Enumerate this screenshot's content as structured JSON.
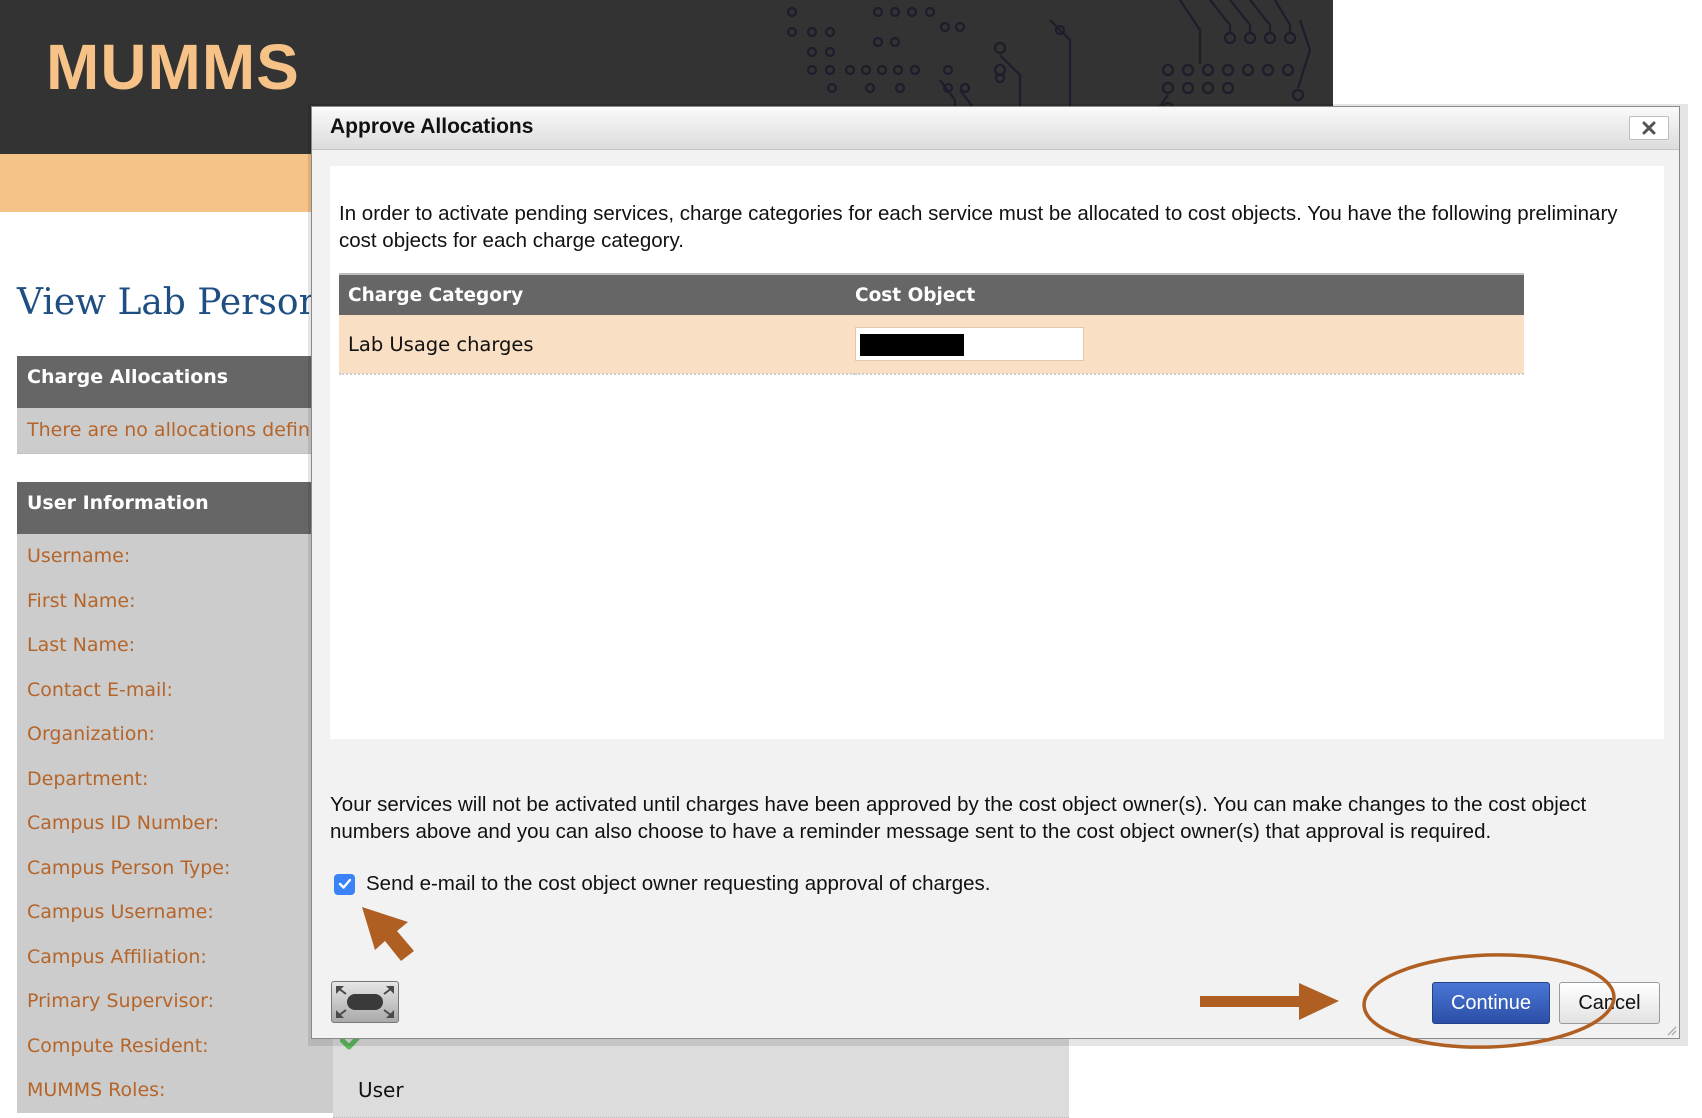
{
  "site": {
    "logo": "MUMMS",
    "page_title": "View Lab Person A",
    "accent_color": "#f5c287",
    "link_color": "#b5652a"
  },
  "charge_allocations": {
    "heading": "Charge Allocations",
    "empty_message": "There are no allocations define"
  },
  "user_information": {
    "heading": "User Information",
    "rows": [
      {
        "label": "Username:",
        "value": ""
      },
      {
        "label": "First Name:",
        "value": ""
      },
      {
        "label": "Last Name:",
        "value": ""
      },
      {
        "label": "Contact E-mail:",
        "value": ""
      },
      {
        "label": "Organization:",
        "value": ""
      },
      {
        "label": "Department:",
        "value": ""
      },
      {
        "label": "Campus ID Number:",
        "value": ""
      },
      {
        "label": "Campus Person Type:",
        "value": ""
      },
      {
        "label": "Campus Username:",
        "value": ""
      },
      {
        "label": "Campus Affiliation:",
        "value": ""
      },
      {
        "label": "Primary Supervisor:",
        "value": ""
      },
      {
        "label": "Compute Resident:",
        "value": "",
        "icon": "check-icon"
      },
      {
        "label": "MUMMS Roles:",
        "value": "User"
      }
    ]
  },
  "dialog": {
    "title": "Approve Allocations",
    "close_icon": "close-icon",
    "intro_text": "In order to activate pending services, charge categories for each service must be allocated to cost objects. You have the following preliminary cost objects for each charge category.",
    "table": {
      "headers": [
        "Charge Category",
        "Cost Object"
      ],
      "rows": [
        {
          "charge_category": "Lab Usage charges",
          "cost_object": "[redacted]"
        }
      ]
    },
    "footer_text": "Your services will not be activated until charges have been approved by the cost object owner(s). You can make changes to the cost object numbers above and you can also choose to have a reminder message sent to the cost object owner(s) that approval is required.",
    "email_checkbox": {
      "label": "Send e-mail to the cost object owner requesting approval of charges.",
      "checked": true
    },
    "maximize_icon": "maximize-icon",
    "buttons": {
      "continue": "Continue",
      "cancel": "Cancel"
    }
  },
  "annotations": {
    "color": "#b05f22",
    "items": [
      "arrow-to-checkbox",
      "arrow-to-continue",
      "circle-around-continue"
    ]
  }
}
